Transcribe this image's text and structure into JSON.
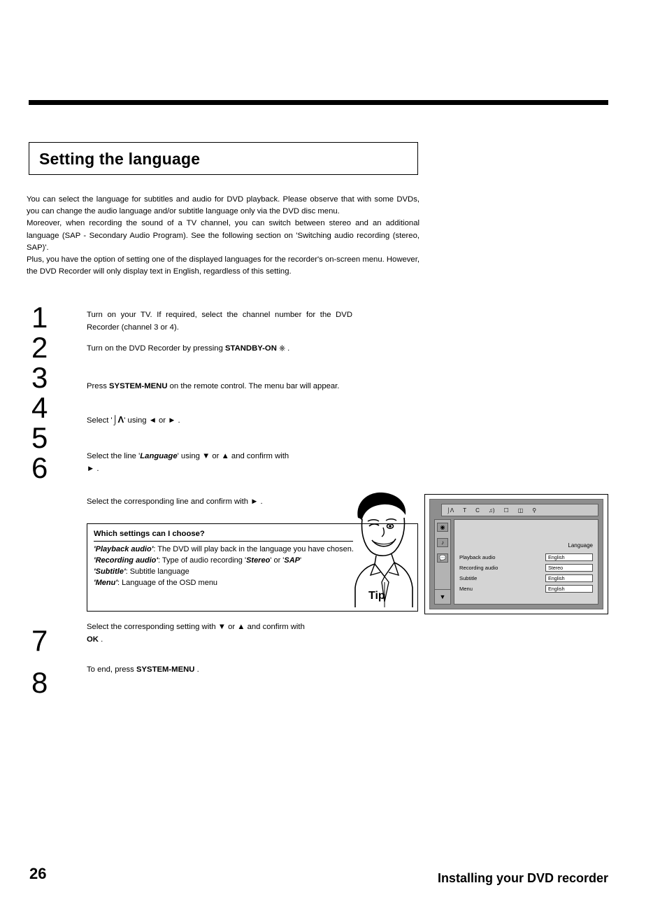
{
  "page": {
    "number": "26",
    "footer_title": "Installing your DVD recorder",
    "heading": "Setting the language"
  },
  "intro": {
    "p1": "You can select the language for subtitles and audio for DVD playback. Please observe that with some DVDs, you can change the audio language and/or subtitle language only via the DVD disc menu.",
    "p2": "Moreover, when recording the sound of a TV channel, you can switch between stereo and an additional language (SAP - Secondary Audio Program). See the following section on 'Switching audio recording (stereo, SAP)'.",
    "p3": "Plus, you have the option of setting one of the displayed languages for the recorder's on-screen menu. However, the DVD Recorder will only display text in English, regardless of this setting."
  },
  "steps": [
    {
      "num": "1",
      "text_pre": "Turn on your TV. If required, select the channel number for the DVD Recorder (channel 3 or 4)."
    },
    {
      "num": "2",
      "text_pre": "Turn on the DVD Recorder by pressing ",
      "bold": "STANDBY-ON",
      "icon": "power-icon",
      "text_post": " ."
    },
    {
      "num": "3",
      "text_pre": "Press ",
      "bold": "SYSTEM-MENU",
      "text_post": " on the remote control. The menu bar will appear."
    },
    {
      "num": "4",
      "text_pre": "Select '",
      "icon": "tools-icon",
      "text_mid": "' using ",
      "icon2": "left-arrow-icon",
      "text_mid2": " or ",
      "icon3": "right-arrow-icon",
      "text_post": " ."
    },
    {
      "num": "5",
      "text_pre": "Select the line '",
      "bolditalic": "Language",
      "text_mid": "' using ",
      "icon": "down-arrow-icon",
      "text_mid2": " or ",
      "icon2": "up-arrow-icon",
      "text_mid3": " and confirm with ",
      "icon3": "right-arrow-icon",
      "text_post": " ."
    },
    {
      "num": "6",
      "text_pre": "Select the corresponding line and confirm with ",
      "icon": "right-arrow-icon",
      "text_post": " ."
    },
    {
      "num": "7",
      "text_pre": "Select the corresponding setting with ",
      "icon": "down-arrow-icon",
      "text_mid": " or ",
      "icon2": "up-arrow-icon",
      "text_mid2": " and confirm with ",
      "bold": "OK",
      "text_post": " ."
    },
    {
      "num": "8",
      "text_pre": "To end, press ",
      "bold": "SYSTEM-MENU",
      "text_post": " ."
    }
  ],
  "tip": {
    "label": "Tip",
    "heading": "Which settings can I choose?",
    "lines": [
      {
        "term": "'Playback audio'",
        "rest": ": The DVD will play back in the language you have chosen."
      },
      {
        "term": "'Recording audio'",
        "rest": ": Type of audio recording '",
        "bold_a": "Stereo",
        "mid": "' or '",
        "bold_b": "SAP",
        "tail": "'"
      },
      {
        "term": "'Subtitle'",
        "rest": ": Subtitle language"
      },
      {
        "term": "'Menu'",
        "rest": ": Language of the OSD menu"
      }
    ]
  },
  "osd": {
    "menubar_icons": [
      "tools-icon",
      "T",
      "C",
      "sound-icon",
      "screen-icon",
      "camera-icon",
      "search-icon"
    ],
    "sidebar_icons": [
      "disc-icon",
      "speaker-icon",
      "speech-bubble-icon"
    ],
    "sidebar_arrow": "down-arrow-icon",
    "panel_title": "Language",
    "rows": [
      {
        "label": "Playback audio",
        "value": "English"
      },
      {
        "label": "Recording audio",
        "value": "Stereo"
      },
      {
        "label": "Subtitle",
        "value": "English"
      },
      {
        "label": "Menu",
        "value": "English"
      }
    ]
  }
}
